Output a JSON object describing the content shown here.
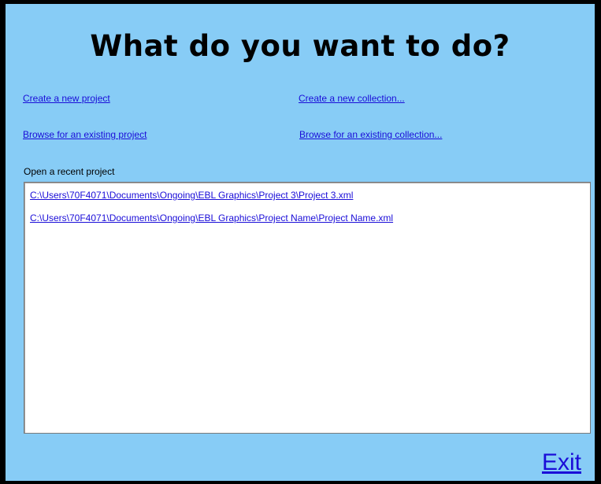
{
  "window": {
    "background_color": "#87ccf6",
    "link_color": "#1a0dd8"
  },
  "header": {
    "title": "What do you want to do?"
  },
  "actions": {
    "create_project": "Create a new project",
    "create_collection": "Create a new collection...",
    "browse_project": "Browse for an existing project",
    "browse_collection": "Browse for an existing collection..."
  },
  "recent": {
    "label": "Open a recent project",
    "items": [
      "C:\\Users\\70F4071\\Documents\\Ongoing\\EBL Graphics\\Project 3\\Project 3.xml",
      "C:\\Users\\70F4071\\Documents\\Ongoing\\EBL Graphics\\Project Name\\Project Name.xml"
    ]
  },
  "footer": {
    "exit_label": "Exit"
  }
}
